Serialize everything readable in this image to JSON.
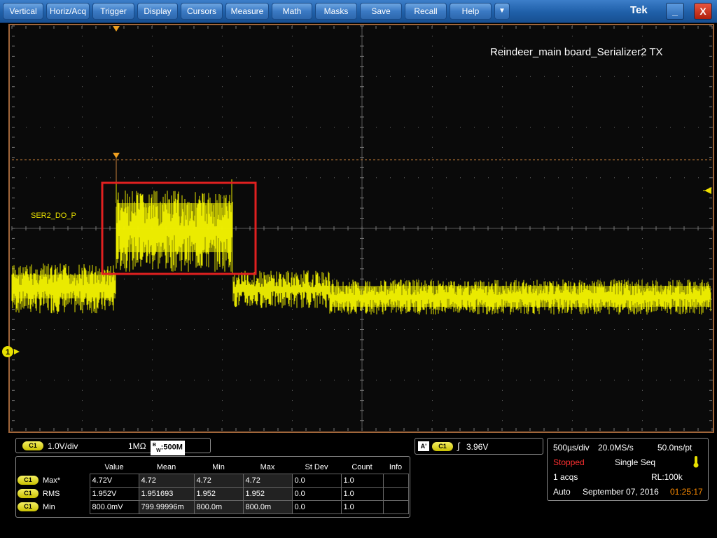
{
  "menu": {
    "items": [
      "Vertical",
      "Horiz/Acq",
      "Trigger",
      "Display",
      "Cursors",
      "Measure",
      "Math",
      "Masks",
      "Save",
      "Recall",
      "Help"
    ],
    "more_glyph": "▼",
    "brand": "Tek",
    "minimize_glyph": "_",
    "close_glyph": "X"
  },
  "screen": {
    "title": "Reindeer_main board_Serializer2 TX",
    "channel_label": "SER2_DO_P",
    "channel_marker": "1",
    "trace_color": "#f0f000",
    "highlight_color": "#e02020"
  },
  "vertical": {
    "channel": "C1",
    "scale": "1.0V/div",
    "impedance": "1MΩ",
    "bw_prefix": "B",
    "bw_sub": "W",
    "bandwidth": ":500M"
  },
  "trigger": {
    "type_glyph": "A'",
    "channel": "C1",
    "slope_glyph": "∫",
    "level": "3.96V"
  },
  "measurements": {
    "headers": [
      "Value",
      "Mean",
      "Min",
      "Max",
      "St Dev",
      "Count",
      "Info"
    ],
    "rows": [
      {
        "channel": "C1",
        "name": "Max*",
        "cells": [
          "4.72V",
          "4.72",
          "4.72",
          "4.72",
          "0.0",
          "1.0",
          ""
        ]
      },
      {
        "channel": "C1",
        "name": "RMS",
        "cells": [
          "1.952V",
          "1.951693",
          "1.952",
          "1.952",
          "0.0",
          "1.0",
          ""
        ]
      },
      {
        "channel": "C1",
        "name": "Min",
        "cells": [
          "800.0mV",
          "799.99996m",
          "800.0m",
          "800.0m",
          "0.0",
          "1.0",
          ""
        ]
      }
    ]
  },
  "acquisition": {
    "time_div": "500µs/div",
    "sample_rate": "20.0MS/s",
    "resolution": "50.0ns/pt",
    "state": "Stopped",
    "mode": "Single Seq",
    "acqs": "1 acqs",
    "record_length": "RL:100k",
    "trigger_mode": "Auto",
    "date": "September 07, 2016",
    "time": "01:25:17",
    "state_color": "#ff3030",
    "time_color": "#ff8c00"
  }
}
